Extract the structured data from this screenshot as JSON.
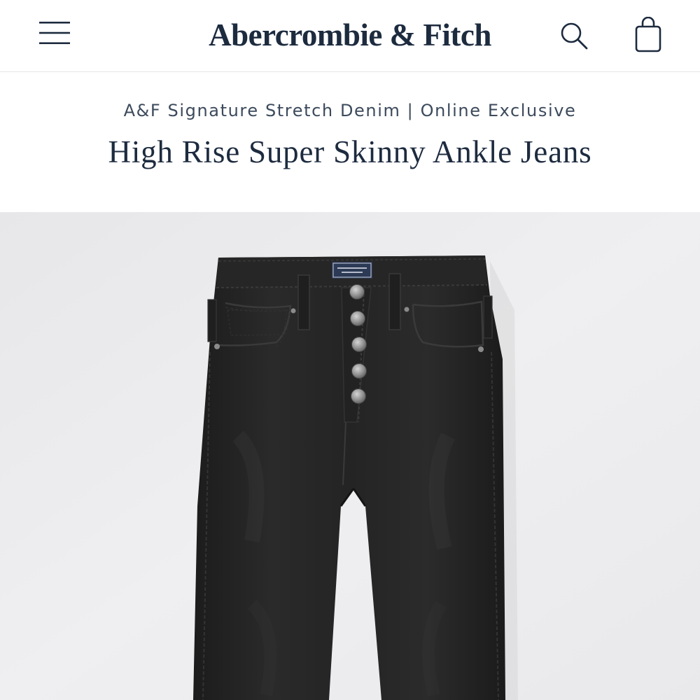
{
  "header": {
    "brand": "Abercrombie & Fitch",
    "menu_icon": "hamburger-menu-icon",
    "search_icon": "search-icon",
    "bag_icon": "shopping-bag-icon"
  },
  "product": {
    "collection": "A&F Signature Stretch Denim | Online Exclusive",
    "title": "High Rise Super Skinny Ankle Jeans",
    "label_text": "Abercrombie & Fitch"
  },
  "colors": {
    "brand_navy": "#1d2b3f",
    "subtitle_gray": "#3c4a5c",
    "image_background": "#ebebed",
    "denim_black": "#232323"
  }
}
